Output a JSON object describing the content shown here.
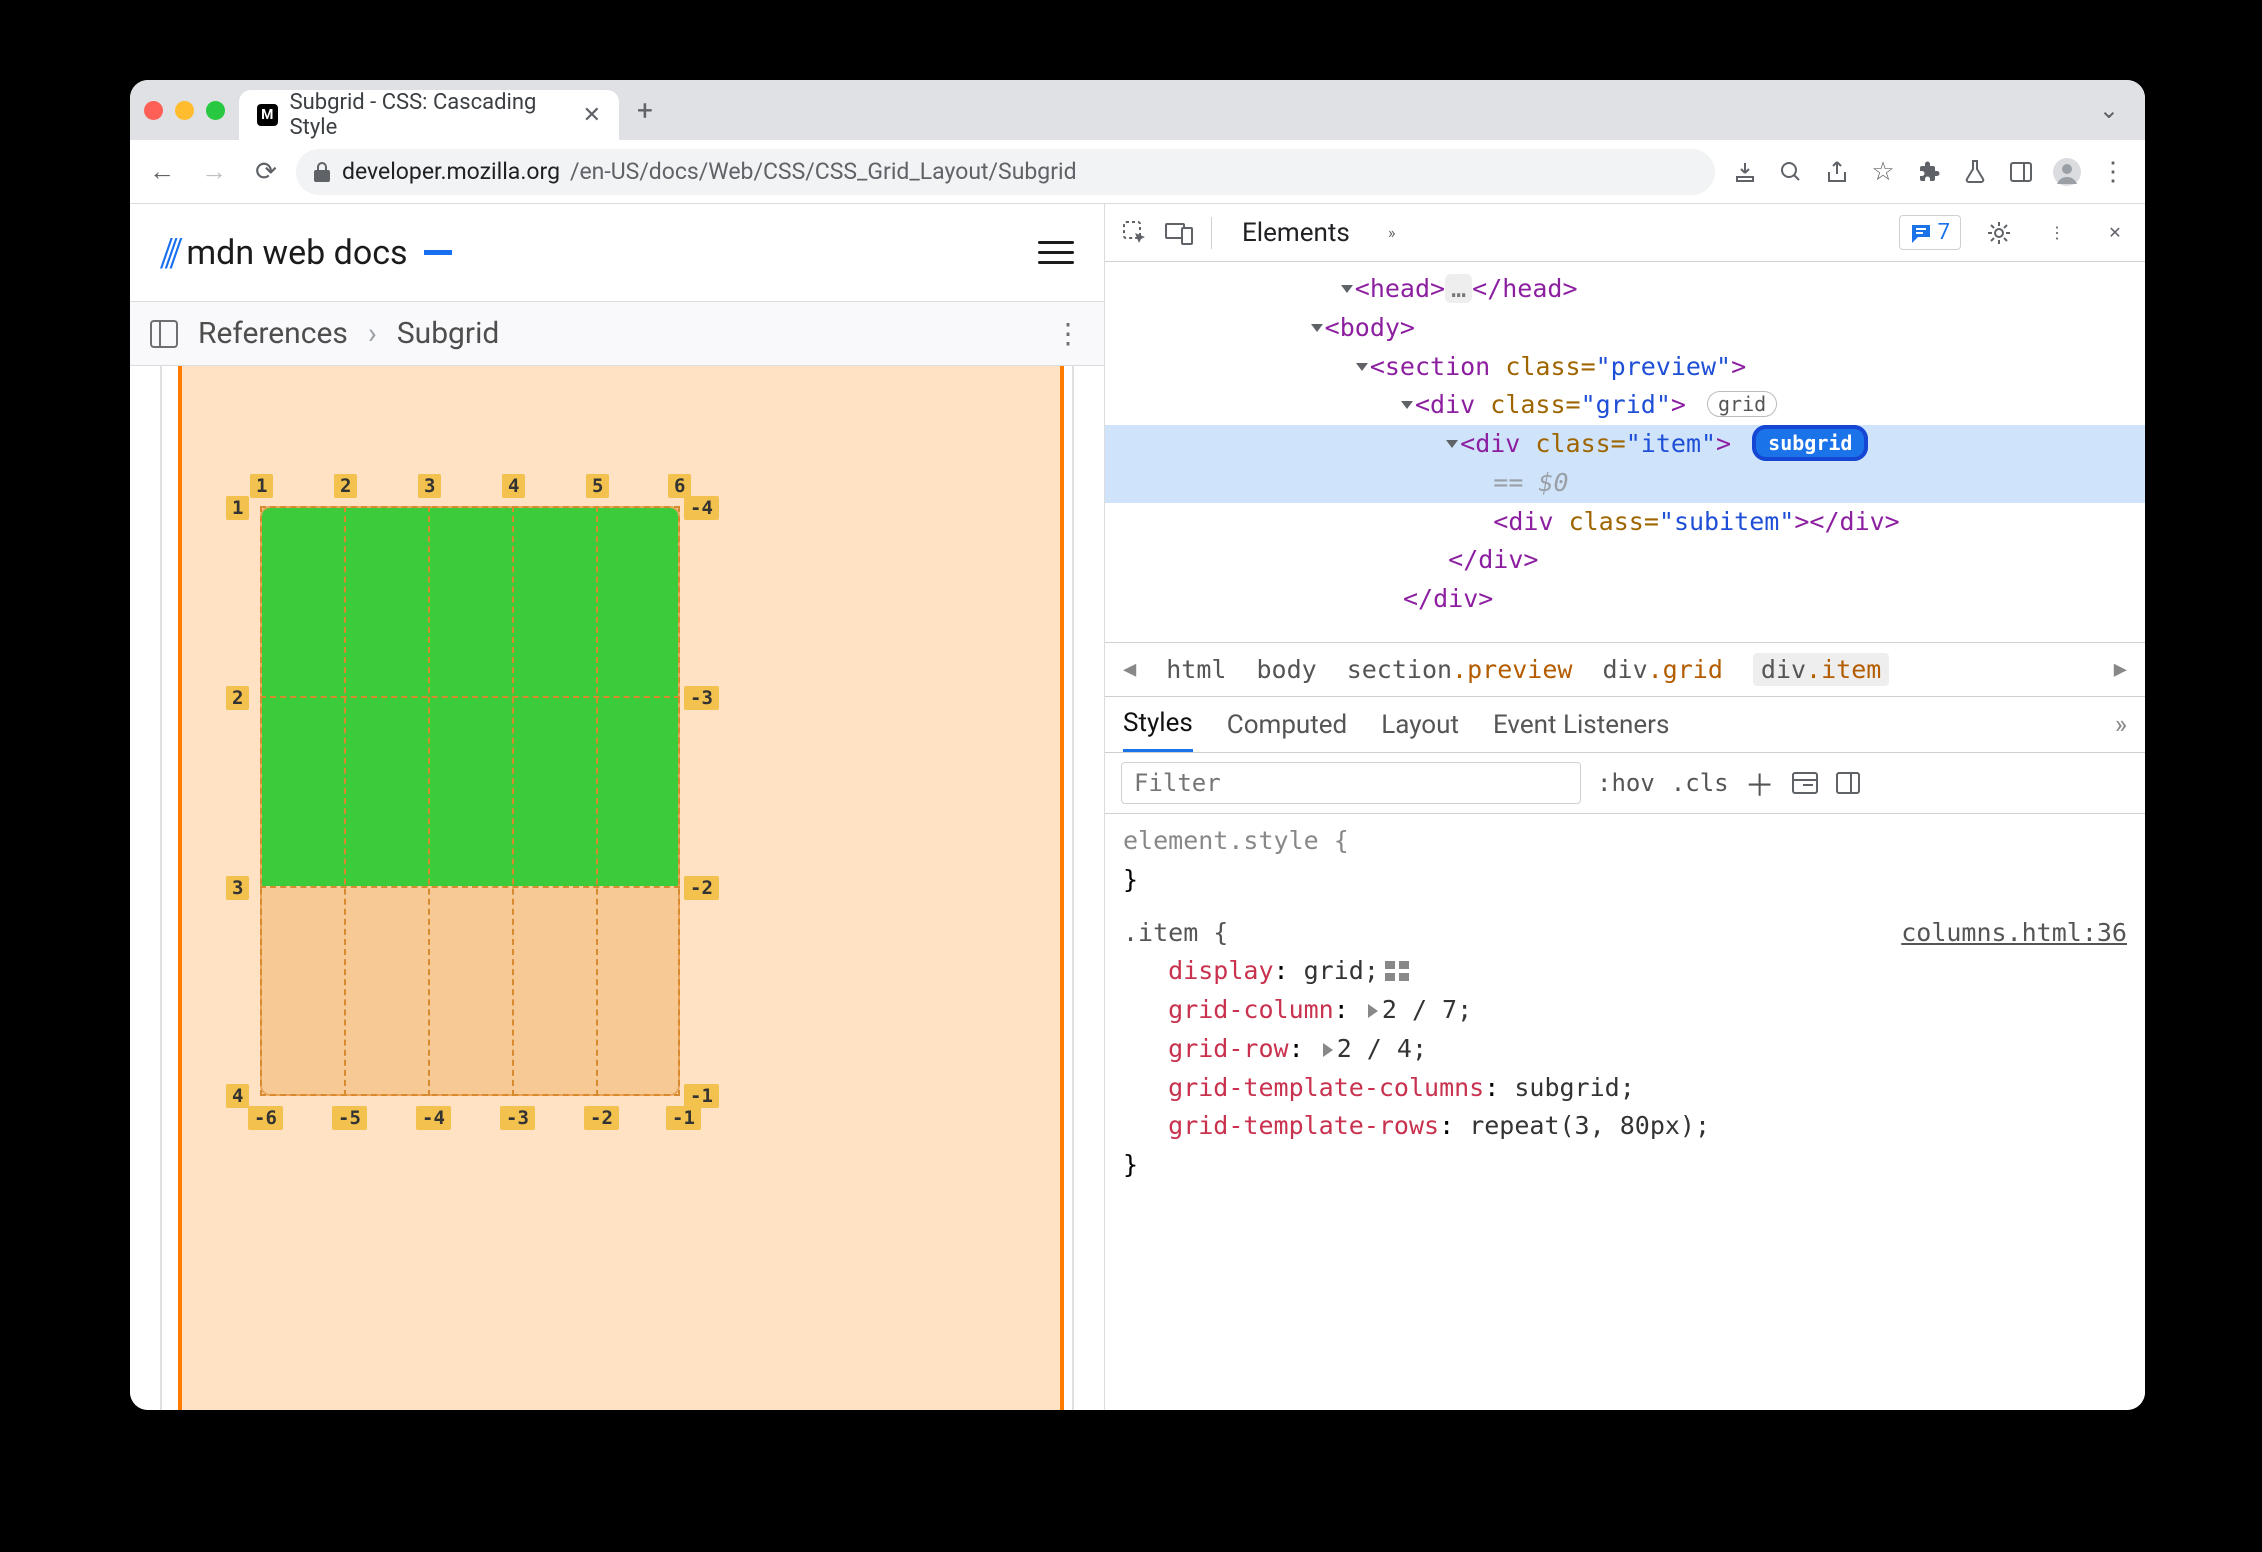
{
  "tab": {
    "title": "Subgrid - CSS: Cascading Style"
  },
  "address": {
    "host": "developer.mozilla.org",
    "path": "/en-US/docs/Web/CSS/CSS_Grid_Layout/Subgrid"
  },
  "mdn": {
    "logo_text": "mdn web docs",
    "crumb1": "References",
    "crumb2": "Subgrid"
  },
  "grid_labels": {
    "top": [
      "1",
      "2",
      "3",
      "4",
      "5",
      "6"
    ],
    "left": [
      "1",
      "2",
      "3",
      "4"
    ],
    "right": [
      "-4",
      "-3",
      "-2",
      "-1"
    ],
    "bottom": [
      "-6",
      "-5",
      "-4",
      "-3",
      "-2",
      "-1"
    ]
  },
  "devtools": {
    "panel": "Elements",
    "issues_count": "7",
    "dom": {
      "l0": "<head>",
      "l0b": "</head>",
      "l1": "<body>",
      "l2a": "<section",
      "l2b": "class=",
      "l2c": "\"preview\"",
      "l2d": ">",
      "l3a": "<div",
      "l3b": "class=",
      "l3c": "\"grid\"",
      "l3d": ">",
      "l3badge": "grid",
      "l4a": "<div",
      "l4b": "class=",
      "l4c": "\"item\"",
      "l4d": ">",
      "l4badge": "subgrid",
      "l4eq": "== $0",
      "l5a": "<div",
      "l5b": "class=",
      "l5c": "\"subitem\"",
      "l5d": "></div>",
      "l6": "</div>",
      "l7": "</div>"
    },
    "path": {
      "p1": "html",
      "p2": "body",
      "p3a": "section",
      "p3b": ".preview",
      "p4a": "div",
      "p4b": ".grid",
      "p5a": "div",
      "p5b": ".item"
    },
    "subtabs": {
      "styles": "Styles",
      "computed": "Computed",
      "layout": "Layout",
      "listeners": "Event Listeners"
    },
    "filter": {
      "placeholder": "Filter",
      "hov": ":hov",
      "cls": ".cls"
    },
    "rules": {
      "inline_sel": "element.style {",
      "inline_close": "}",
      "item_sel": ".item {",
      "item_src": "columns.html:36",
      "p1k": "display",
      "p1v": "grid;",
      "p2k": "grid-column",
      "p2v": "2 / 7;",
      "p3k": "grid-row",
      "p3v": "2 / 4;",
      "p4k": "grid-template-columns",
      "p4v": "subgrid;",
      "p5k": "grid-template-rows",
      "p5v": "repeat(3, 80px);",
      "close": "}"
    }
  }
}
